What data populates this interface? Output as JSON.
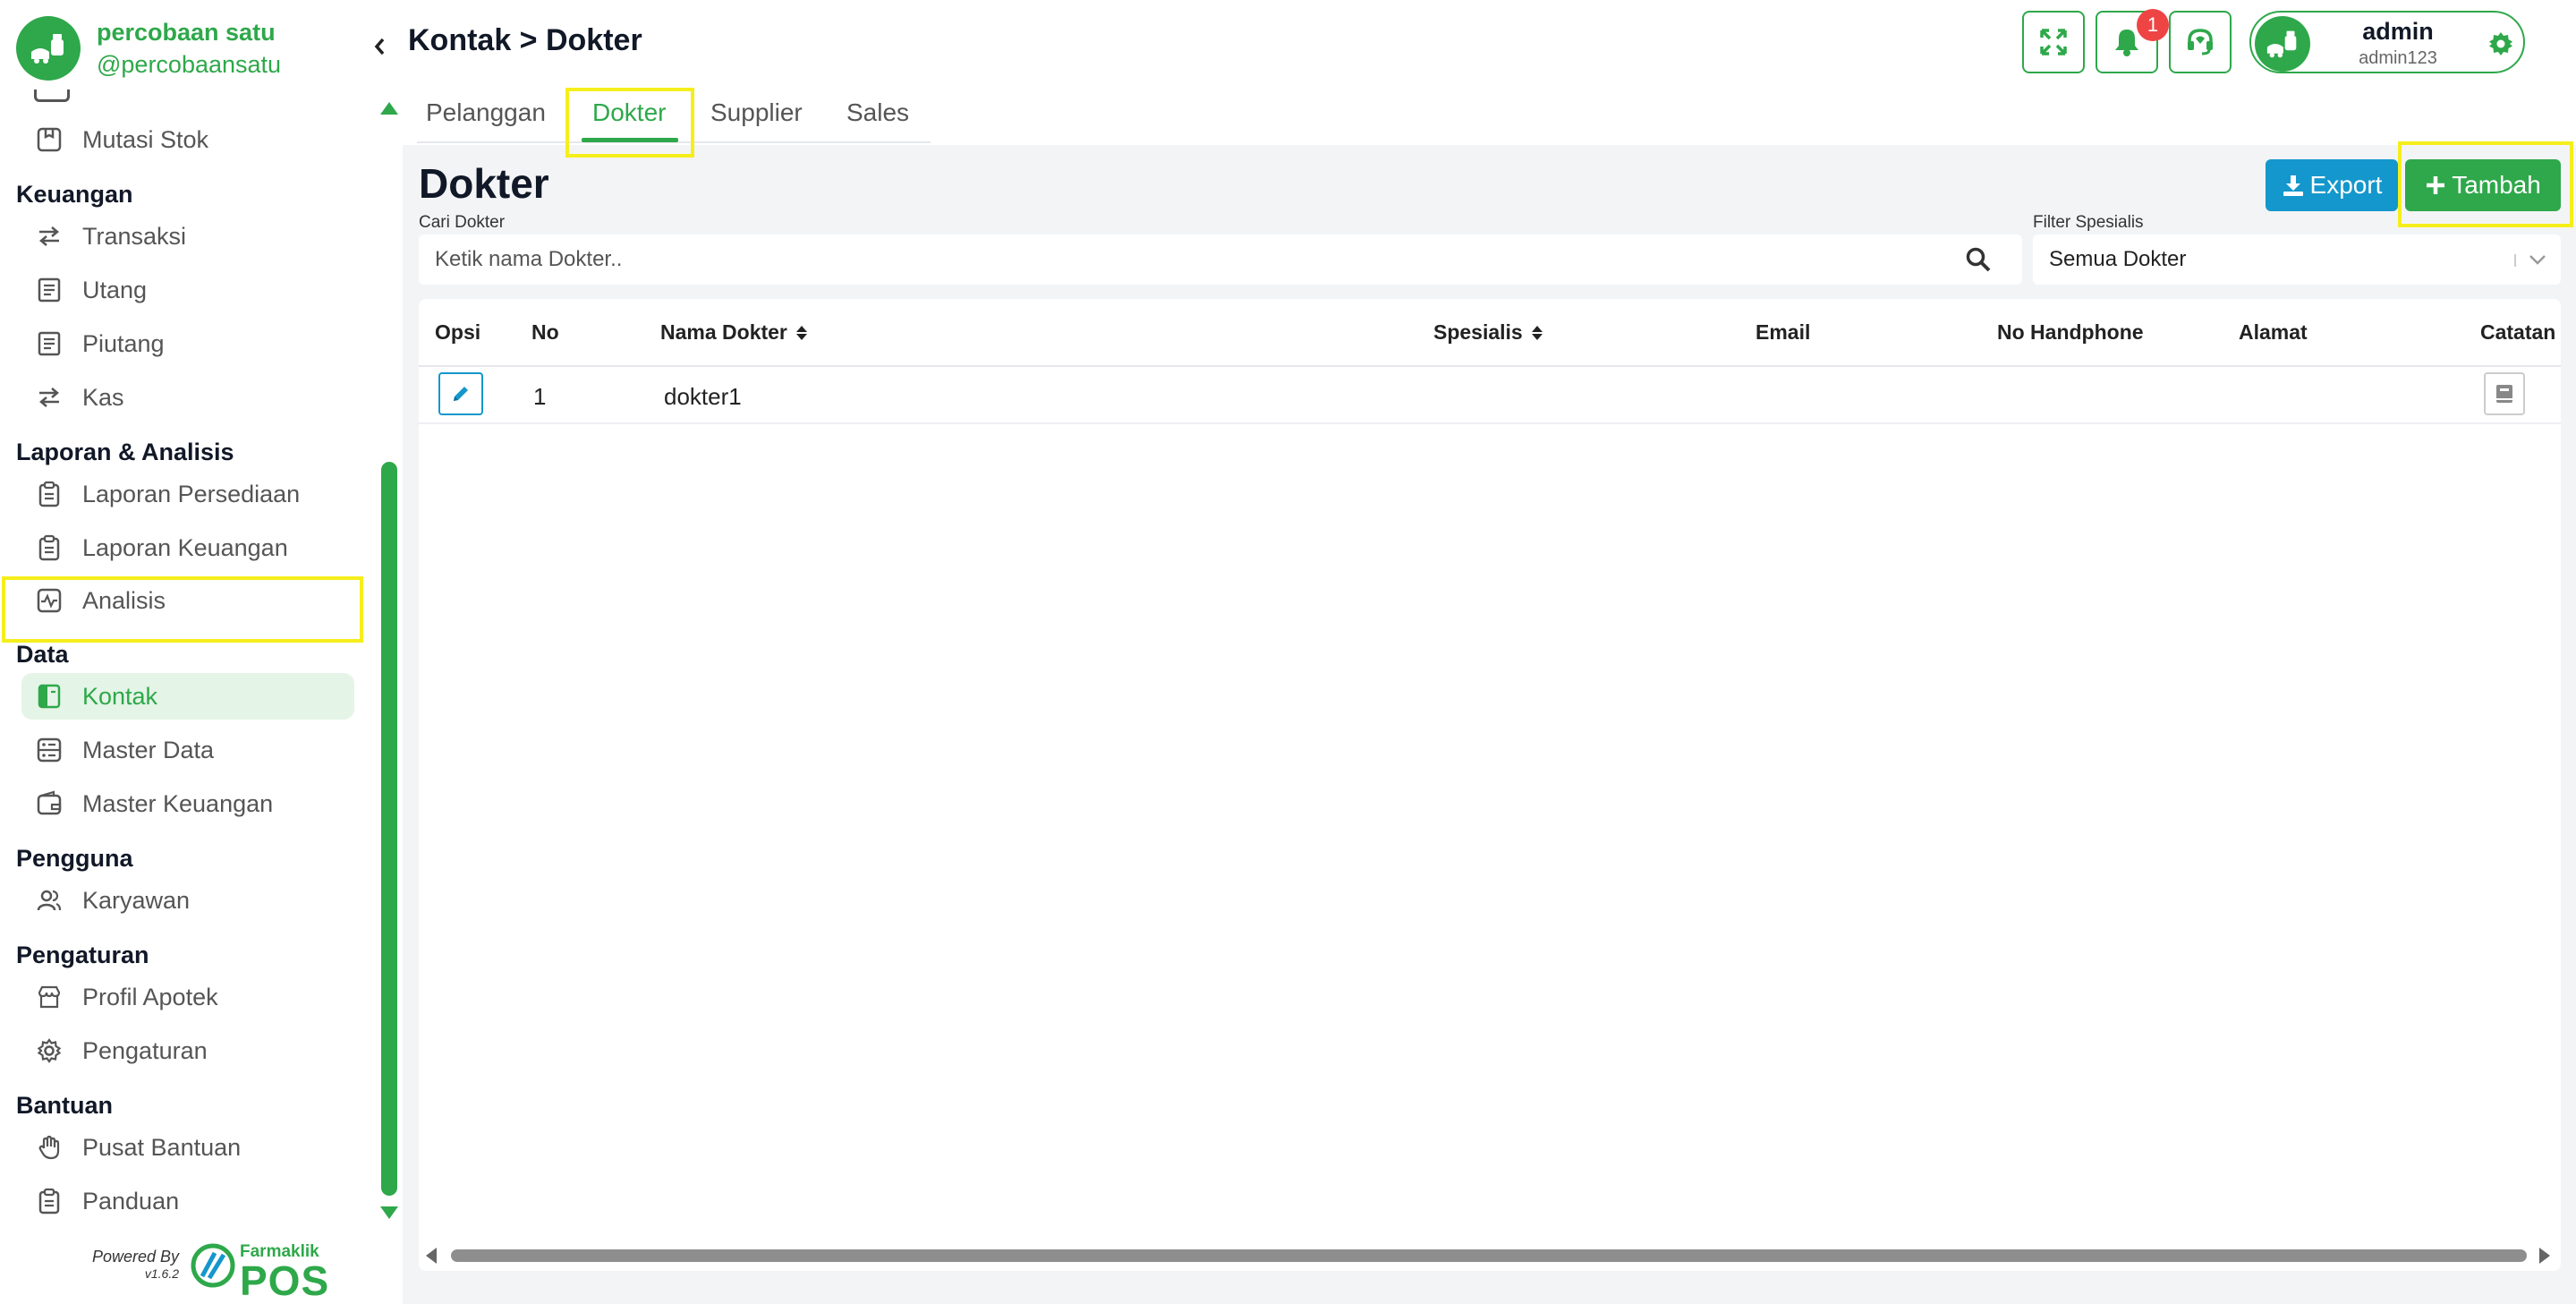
{
  "brand": {
    "name": "percobaan satu",
    "handle": "@percobaansatu"
  },
  "sidebar": {
    "items_top": [
      {
        "label": "Mutasi Stok",
        "icon": "box-icon"
      }
    ],
    "sections": [
      {
        "title": "Keuangan",
        "items": [
          {
            "label": "Transaksi",
            "icon": "transfer-icon"
          },
          {
            "label": "Utang",
            "icon": "receipt-icon"
          },
          {
            "label": "Piutang",
            "icon": "receipt-icon"
          },
          {
            "label": "Kas",
            "icon": "transfer-icon"
          }
        ]
      },
      {
        "title": "Laporan & Analisis",
        "items": [
          {
            "label": "Laporan Persediaan",
            "icon": "clipboard-icon"
          },
          {
            "label": "Laporan Keuangan",
            "icon": "clipboard-icon"
          },
          {
            "label": "Analisis",
            "icon": "activity-icon"
          }
        ]
      },
      {
        "title": "Data",
        "items": [
          {
            "label": "Kontak",
            "icon": "contact-book-icon",
            "active": true
          },
          {
            "label": "Master Data",
            "icon": "database-icon"
          },
          {
            "label": "Master Keuangan",
            "icon": "wallet-icon"
          }
        ]
      },
      {
        "title": "Pengguna",
        "items": [
          {
            "label": "Karyawan",
            "icon": "users-icon"
          }
        ]
      },
      {
        "title": "Pengaturan",
        "items": [
          {
            "label": "Profil Apotek",
            "icon": "store-icon"
          },
          {
            "label": "Pengaturan",
            "icon": "gear-icon"
          }
        ]
      },
      {
        "title": "Bantuan",
        "items": [
          {
            "label": "Pusat Bantuan",
            "icon": "hand-icon"
          },
          {
            "label": "Panduan",
            "icon": "clipboard-icon"
          }
        ]
      }
    ],
    "powered_by": "Powered By",
    "version": "v1.6.2",
    "footer_brand": "Farmaklik",
    "footer_product": "POS"
  },
  "header": {
    "breadcrumb": "Kontak > Dokter",
    "notification_count": "1",
    "user_name": "admin",
    "user_handle": "admin123"
  },
  "tabs": [
    {
      "label": "Pelanggan"
    },
    {
      "label": "Dokter",
      "active": true
    },
    {
      "label": "Supplier"
    },
    {
      "label": "Sales"
    }
  ],
  "page": {
    "title": "Dokter",
    "export_label": "Export",
    "add_label": "Tambah",
    "search_label": "Cari Dokter",
    "search_placeholder": "Ketik nama Dokter..",
    "filter_label": "Filter Spesialis",
    "filter_value": "Semua Dokter"
  },
  "table": {
    "columns": [
      "Opsi",
      "No",
      "Nama Dokter",
      "Spesialis",
      "Email",
      "No Handphone",
      "Alamat",
      "Catatan"
    ],
    "rows": [
      {
        "no": "1",
        "nama": "dokter1",
        "spesialis": "",
        "email": "",
        "handphone": "",
        "alamat": ""
      }
    ]
  },
  "colors": {
    "primary": "#2ea84a",
    "info": "#1497cc",
    "highlight": "#f5ee1b",
    "badge": "#ef4444"
  }
}
